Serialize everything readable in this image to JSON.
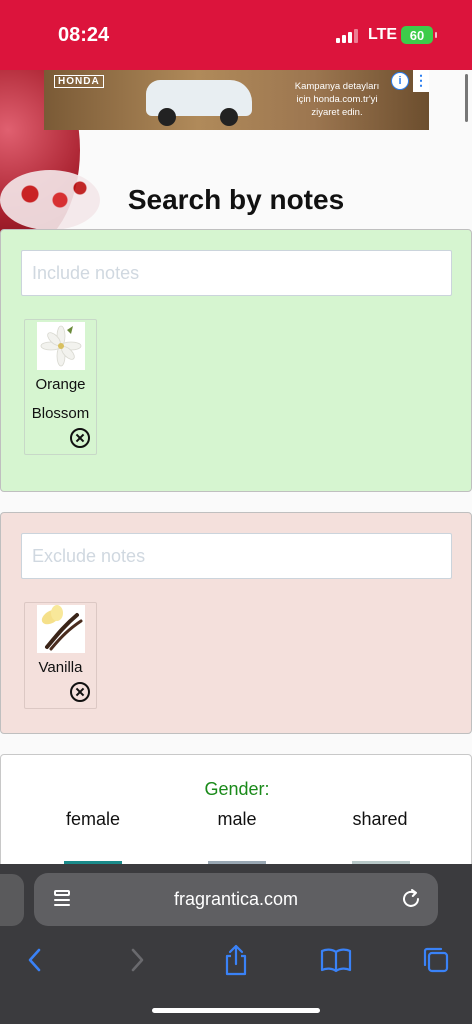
{
  "status_bar": {
    "time": "08:24",
    "network": "LTE",
    "battery": "60"
  },
  "ad": {
    "brand": "HONDA",
    "text_line1": "Kampanya detayları",
    "text_line2": "için honda.com.tr'yi",
    "text_line3": "ziyaret edin.",
    "info": "i",
    "menu": "⋮"
  },
  "search": {
    "title": "Search by notes"
  },
  "include": {
    "placeholder": "Include notes",
    "notes": [
      {
        "line1": "Orange",
        "line2": "Blossom"
      }
    ]
  },
  "exclude": {
    "placeholder": "Exclude notes",
    "notes": [
      {
        "line1": "Vanilla"
      }
    ]
  },
  "gender": {
    "label": "Gender:",
    "options": [
      {
        "label": "female"
      },
      {
        "label": "male"
      },
      {
        "label": "shared"
      }
    ]
  },
  "browser": {
    "url": "fragrantica.com"
  },
  "colors": {
    "status_bar": "#dc143c",
    "include_panel": "#d6f5d0",
    "exclude_panel": "#f4e0dc",
    "gender_label": "#1a8a1a",
    "toolbar_blue": "#3a82f7",
    "female_bar": "#1a8a8a",
    "male_bar": "#9aa8b4",
    "shared_bar": "#b8c8c8"
  }
}
